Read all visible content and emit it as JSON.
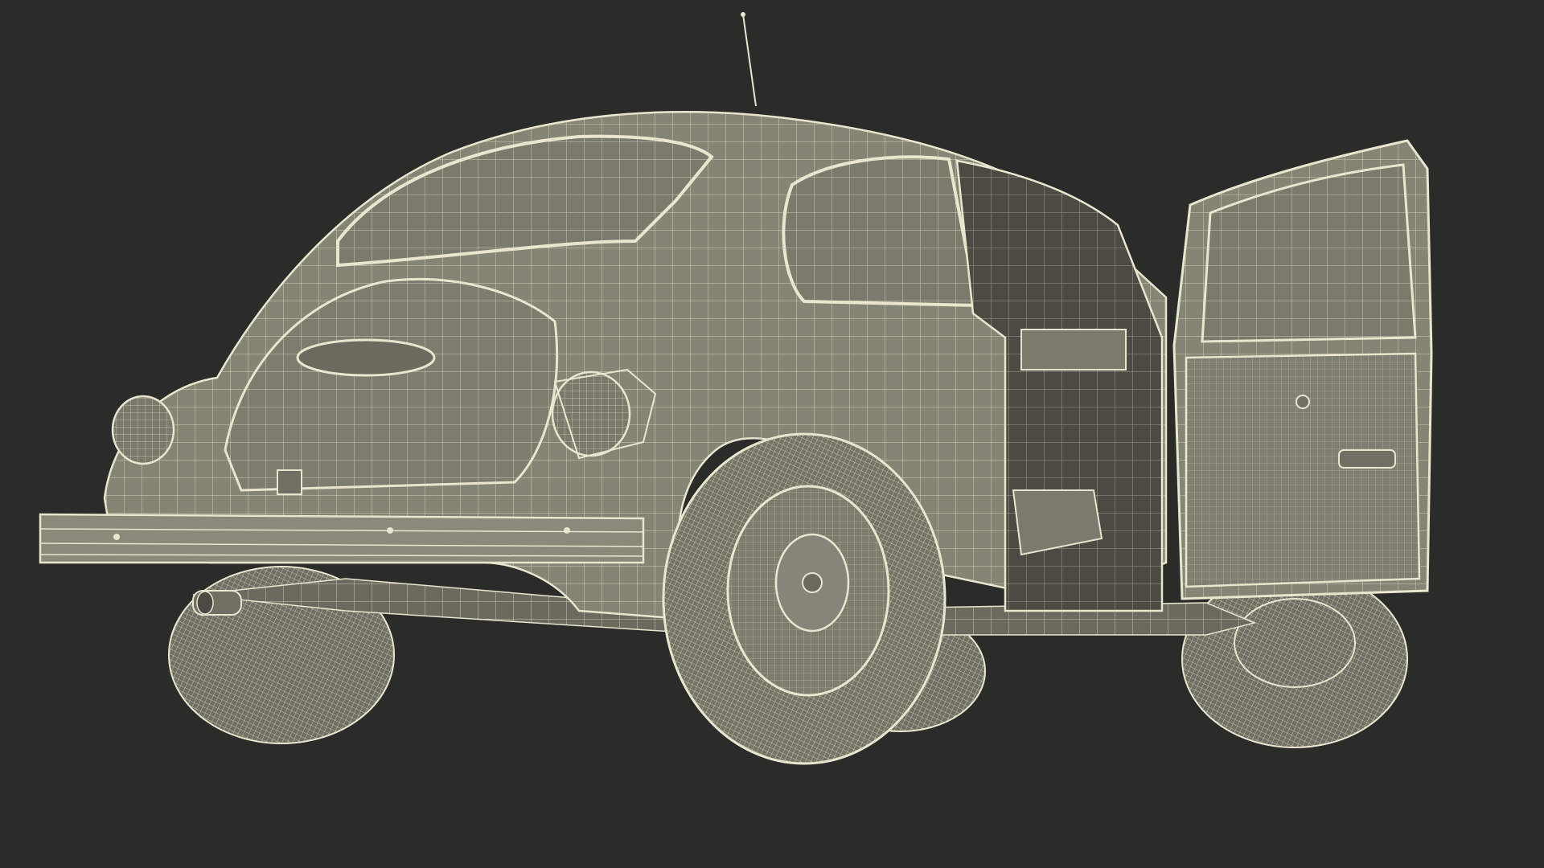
{
  "scene": {
    "subject": "car-wireframe-render",
    "background_color": "#2b2b2a",
    "body_fill_color": "#8a8a7a",
    "wire_color": "#e8e6cf",
    "shadow_color": "#5f5f55",
    "dark_interior_color": "#4b4b43"
  }
}
